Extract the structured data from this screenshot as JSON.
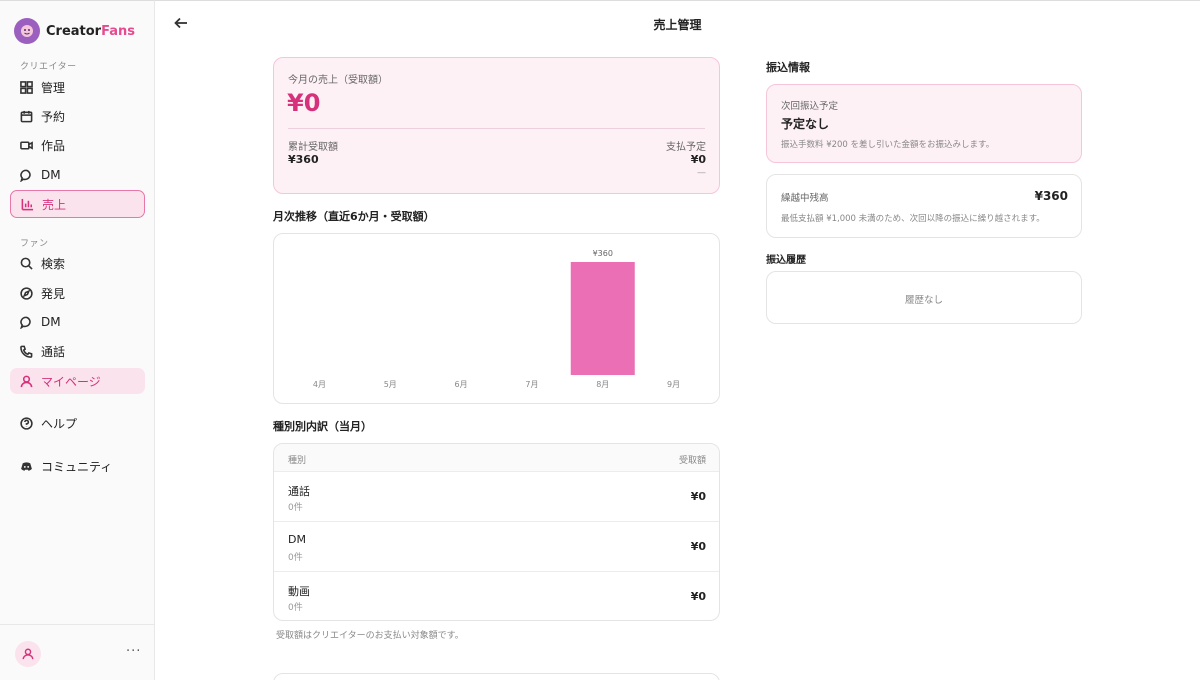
{
  "brand": {
    "name_prefix": "Creator",
    "name_suffix": "Fans"
  },
  "colors": {
    "accent": "#d6327b",
    "bar": "#ea6fb4",
    "pink_bg": "#fdf1f6"
  },
  "sidebar": {
    "section_creator": "クリエイター",
    "creator_items": [
      {
        "label": "管理",
        "icon": "grid-icon"
      },
      {
        "label": "予約",
        "icon": "calendar-icon"
      },
      {
        "label": "作品",
        "icon": "video-icon"
      },
      {
        "label": "DM",
        "icon": "chat-icon"
      },
      {
        "label": "売上",
        "icon": "bar-chart-icon",
        "active": true
      }
    ],
    "section_fan": "ファン",
    "fan_items": [
      {
        "label": "検索",
        "icon": "search-icon"
      },
      {
        "label": "発見",
        "icon": "compass-icon"
      },
      {
        "label": "DM",
        "icon": "chat-icon"
      },
      {
        "label": "通話",
        "icon": "phone-icon"
      },
      {
        "label": "マイページ",
        "icon": "user-icon",
        "highlighted": true
      }
    ],
    "help": "ヘルプ",
    "community": "コミュニティ",
    "more": "···"
  },
  "header": {
    "title": "売上管理"
  },
  "summary": {
    "month_label": "今月の売上（受取額）",
    "month_value": "¥0",
    "total_label": "累計受取額",
    "total_value": "¥360",
    "planned_label": "支払予定",
    "planned_value": "¥0",
    "planned_sub": "—"
  },
  "chart_section_title": "月次推移（直近6か月・受取額）",
  "chart_data": {
    "type": "bar",
    "categories": [
      "4月",
      "5月",
      "6月",
      "7月",
      "8月",
      "9月"
    ],
    "values": [
      0,
      0,
      0,
      0,
      360,
      0
    ],
    "value_labels": [
      "",
      "",
      "",
      "",
      "¥360",
      ""
    ],
    "title": "",
    "xlabel": "",
    "ylabel": "",
    "ylim": [
      0,
      360
    ],
    "grid": false
  },
  "breakdown": {
    "title": "種別別内訳（当月）",
    "col_type": "種別",
    "col_amount": "受取額",
    "rows": [
      {
        "name": "通話",
        "count": "0件",
        "amount": "¥0"
      },
      {
        "name": "DM",
        "count": "0件",
        "amount": "¥0"
      },
      {
        "name": "動画",
        "count": "0件",
        "amount": "¥0"
      }
    ],
    "note": "受取額はクリエイターのお支払い対象額です。"
  },
  "transfer_info": {
    "title": "振込情報",
    "next_label": "次回振込予定",
    "next_value": "予定なし",
    "next_note": "振込手数料 ¥200 を差し引いた金額をお振込みします。",
    "carry_label": "繰越中残高",
    "carry_value": "¥360",
    "carry_note": "最低支払額 ¥1,000 未満のため、次回以降の振込に繰り越されます。",
    "history_title": "振込履歴",
    "history_empty": "履歴なし"
  }
}
